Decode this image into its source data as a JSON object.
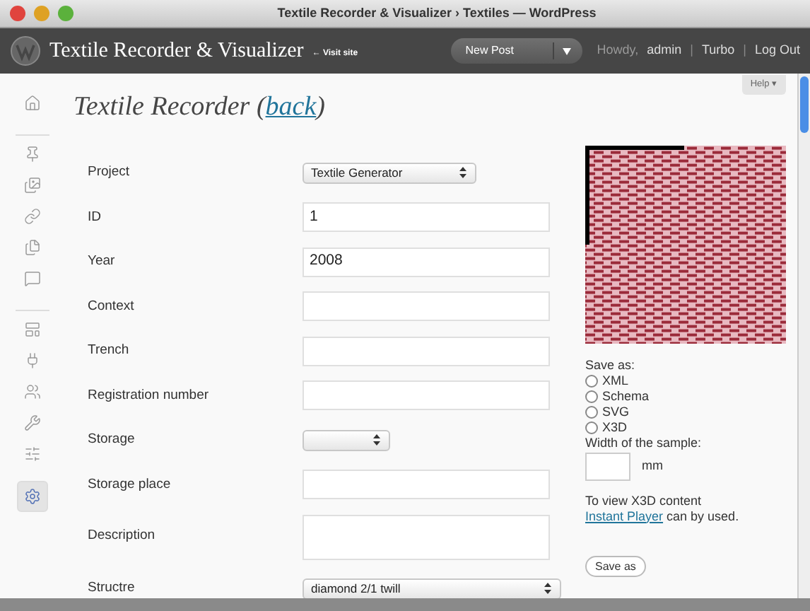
{
  "window": {
    "title": "Textile Recorder & Visualizer › Textiles — WordPress"
  },
  "admin_bar": {
    "site_title": "Textile Recorder & Visualizer",
    "visit_link": "← Visit site",
    "new_post": "New Post",
    "howdy": "Howdy,",
    "user": "admin",
    "separator": "|",
    "links": [
      {
        "label": "Turbo"
      },
      {
        "label": "Log Out"
      }
    ]
  },
  "help": "Help ▾",
  "heading": {
    "title": "Textile Recorder (",
    "link": "back",
    "close": ")"
  },
  "sidebar": {
    "items": [
      {
        "kind": "home",
        "selected": false
      },
      {
        "kind": "sep"
      },
      {
        "kind": "pin",
        "selected": false
      },
      {
        "kind": "media",
        "selected": false
      },
      {
        "kind": "link",
        "selected": false
      },
      {
        "kind": "pages",
        "selected": false
      },
      {
        "kind": "comments",
        "selected": false
      },
      {
        "kind": "sep"
      },
      {
        "kind": "appearance",
        "selected": false
      },
      {
        "kind": "plugins",
        "selected": false
      },
      {
        "kind": "users",
        "selected": false
      },
      {
        "kind": "tools",
        "selected": false
      },
      {
        "kind": "settings",
        "selected": false
      },
      {
        "kind": "gear",
        "selected": true
      }
    ]
  },
  "form": [
    {
      "label": "Project",
      "kind": "select",
      "value": "Textile Generator"
    },
    {
      "label": "ID",
      "kind": "text",
      "value": "1"
    },
    {
      "label": "Year",
      "kind": "text",
      "value": "2008"
    },
    {
      "label": "Context",
      "kind": "text"
    },
    {
      "label": "Trench",
      "kind": "text"
    },
    {
      "label": "Registration number",
      "kind": "text"
    },
    {
      "label": "Storage",
      "kind": "short_select"
    },
    {
      "label": "Storage place",
      "kind": "text"
    },
    {
      "label": "Description",
      "kind": "textarea"
    },
    {
      "label": "Structre",
      "kind": "wide_select",
      "value": "diamond 2/1 twill"
    }
  ],
  "save_panel": {
    "save_as_label": "Save as:",
    "formats": [
      {
        "label": "XML",
        "selected": false
      },
      {
        "label": "Schema",
        "selected": false
      },
      {
        "label": "SVG",
        "selected": false
      },
      {
        "label": "X3D",
        "selected": false
      }
    ],
    "width_label": "Width of the sample:",
    "unit": "mm",
    "note": "To view X3D content ",
    "note_link": "Instant Player",
    "note_end": " can by used.",
    "button": "Save as"
  }
}
